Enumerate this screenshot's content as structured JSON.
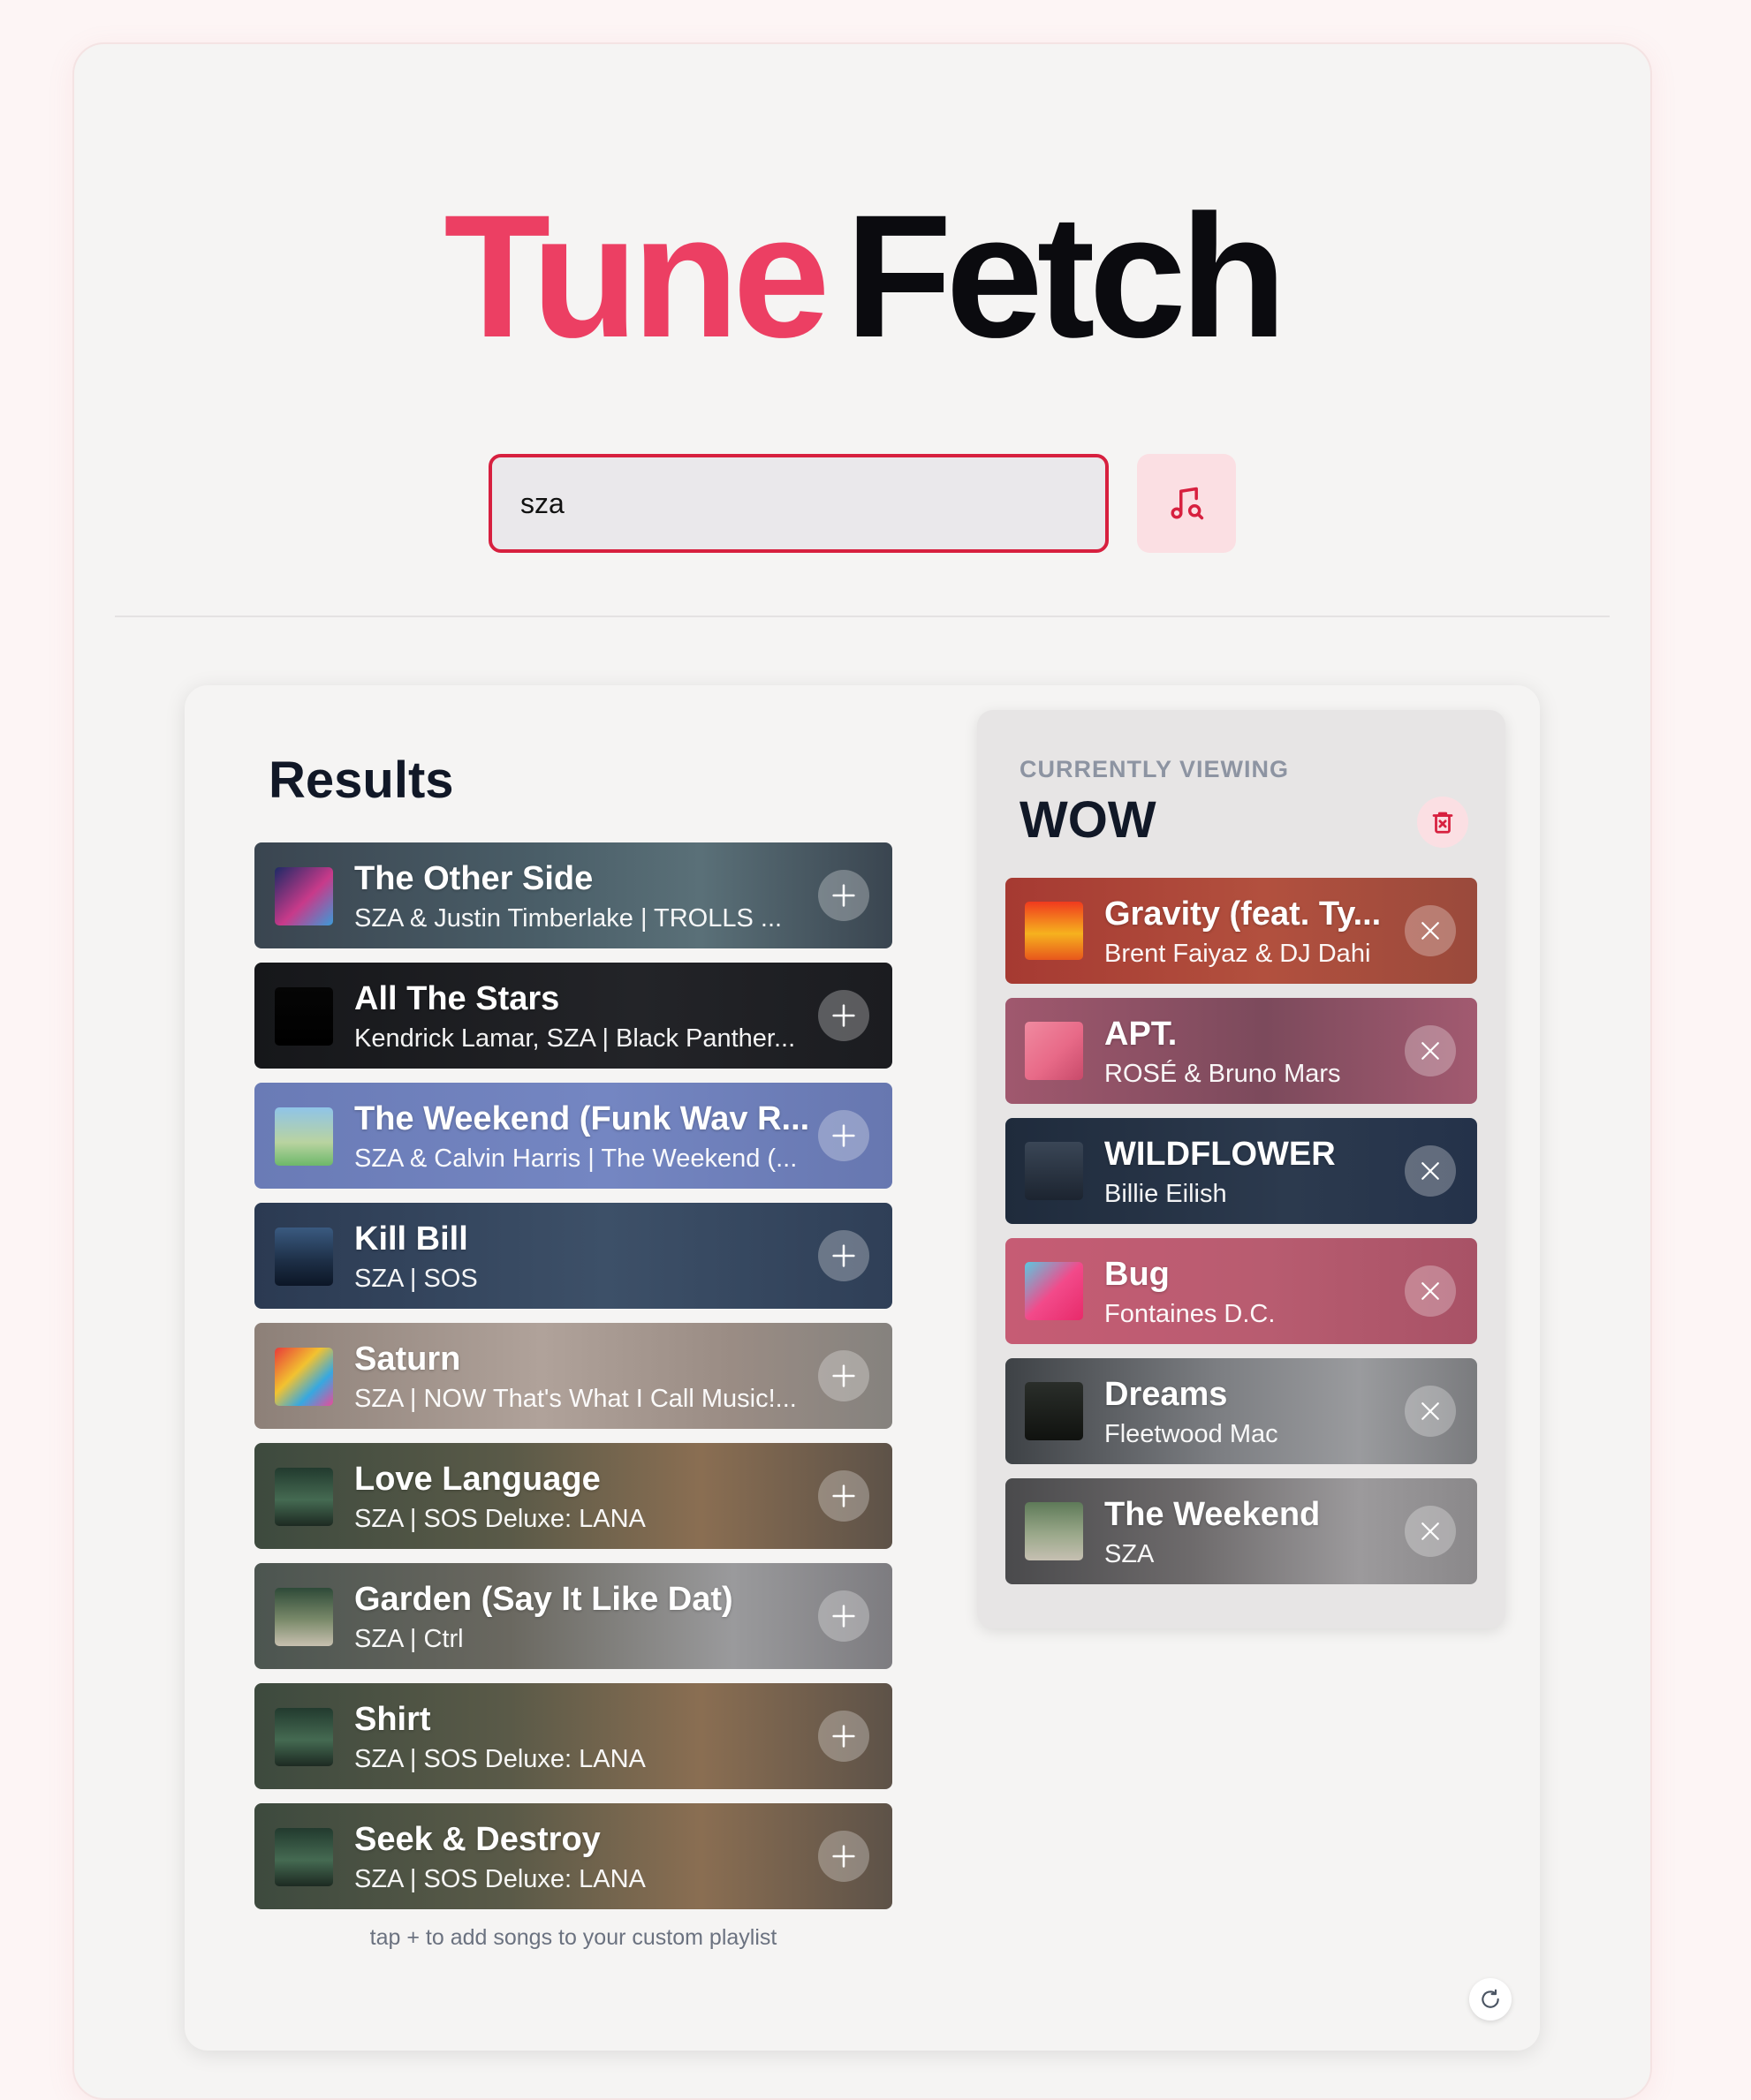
{
  "app": {
    "logo_part1": "Tune",
    "logo_part2": "Fetch",
    "brand_color": "#ec3f63"
  },
  "search": {
    "value": "sza",
    "button_icon": "music-search-icon"
  },
  "results": {
    "title": "Results",
    "hint": "tap + to add songs to your custom playlist",
    "items": [
      {
        "title": "The Other Side",
        "subtitle": "SZA & Justin Timberlake | TROLLS ...",
        "bg": "linear-gradient(90deg,#3a4550 0%,#4a5e68 45%,#5a7078 70%,#3a4550 100%)",
        "art": "linear-gradient(135deg,#1d2a66,#c83a8a 55%,#3b9bd8)"
      },
      {
        "title": "All The Stars",
        "subtitle": "Kendrick Lamar, SZA | Black Panther...",
        "bg": "linear-gradient(90deg,#16171a 0%,#232428 60%,#1b1c20 100%)",
        "art": "linear-gradient(180deg,#050505,#000000)"
      },
      {
        "title": "The Weekend (Funk Wav R...",
        "subtitle": "SZA & Calvin Harris | The Weekend (...",
        "bg": "linear-gradient(90deg,#6a7bb6 0%,#7486c2 55%,#6777b0 100%)",
        "art": "linear-gradient(180deg,#8fc4e8,#b9d3a0 60%,#6db86a)"
      },
      {
        "title": "Kill Bill",
        "subtitle": "SZA | SOS",
        "bg": "linear-gradient(90deg,#2b3a52 0%,#3d5068 55%,#2f3f57 100%)",
        "art": "linear-gradient(180deg,#3a5a80,#1c2d44 60%,#0c1626)"
      },
      {
        "title": "Saturn",
        "subtitle": "SZA | NOW That's What I Call Music!...",
        "bg": "linear-gradient(90deg,#8d8078 0%,#b0a29a 45%,#9a8c84 75%,#85827e 100%)",
        "art": "linear-gradient(135deg,#e83a3a,#f2c230 40%,#37a8e0 70%,#e84b9a)"
      },
      {
        "title": "Love Language",
        "subtitle": "SZA | SOS Deluxe: LANA",
        "bg": "linear-gradient(90deg,#3d4a3e 0%,#5a5a48 40%,#8a6e52 70%,#5d5248 100%)",
        "art": "linear-gradient(180deg,#223a2e,#456a52 55%,#1d2a22)"
      },
      {
        "title": "Garden (Say It Like Dat)",
        "subtitle": "SZA | Ctrl",
        "bg": "linear-gradient(90deg,#4c5550 0%,#6a6860 40%,#9a9a9c 75%,#7d7c80 100%)",
        "art": "linear-gradient(180deg,#2e4a38,#7a8a6a 55%,#c8c0b0)"
      },
      {
        "title": "Shirt",
        "subtitle": "SZA | SOS Deluxe: LANA",
        "bg": "linear-gradient(90deg,#3d4a3e 0%,#5a5a48 40%,#8a6e52 70%,#5d5248 100%)",
        "art": "linear-gradient(180deg,#223a2e,#456a52 55%,#1d2a22)"
      },
      {
        "title": "Seek & Destroy",
        "subtitle": "SZA | SOS Deluxe: LANA",
        "bg": "linear-gradient(90deg,#3d4a3e 0%,#5a5a48 40%,#8a6e52 70%,#5d5248 100%)",
        "art": "linear-gradient(180deg,#223a2e,#456a52 55%,#1d2a22)"
      }
    ]
  },
  "playlist": {
    "label": "CURRENTLY VIEWING",
    "name": "WOW",
    "delete_icon": "trash-icon",
    "items": [
      {
        "title": "Gravity (feat. Ty...",
        "subtitle": "Brent Faiyaz & DJ Dahi",
        "bg": "linear-gradient(90deg,#a63a32 0%,#b2503e 55%,#9a4a3c 100%)",
        "art": "linear-gradient(180deg,#f03a1e,#f6b21e 55%,#e8561c)"
      },
      {
        "title": "APT.",
        "subtitle": "ROSÉ & Bruno Mars",
        "bg": "linear-gradient(90deg,#a0586e 0%,#7c4a5c 55%,#a25a70 100%)",
        "art": "linear-gradient(135deg,#f08aa0,#e86a88 55%,#c84a6a)"
      },
      {
        "title": "WILDFLOWER",
        "subtitle": "Billie Eilish",
        "bg": "linear-gradient(90deg,#1f2b3c 0%,#2c3a4e 60%,#24324a 100%)",
        "art": "linear-gradient(180deg,#3a4656,#1c2430)"
      },
      {
        "title": "Bug",
        "subtitle": "Fontaines D.C.",
        "bg": "linear-gradient(90deg,#c65c74 0%,#b85c70 55%,#a85266 100%)",
        "art": "linear-gradient(135deg,#5ac8e0,#f24a8a 50%,#e82a6a)"
      },
      {
        "title": "Dreams",
        "subtitle": "Fleetwood Mac",
        "bg": "linear-gradient(90deg,#3e4246 0%,#7c7e82 45%,#9a9b9e 75%,#7a7b7e 100%)",
        "art": "linear-gradient(180deg,#2a2e2a,#10120f)"
      },
      {
        "title": "The Weekend",
        "subtitle": "SZA",
        "bg": "linear-gradient(90deg,#4a4a4c 0%,#6e6b6c 40%,#9c9a9c 75%,#8a888a 100%)",
        "art": "linear-gradient(180deg,#5e7a58,#9aa88a 55%,#c6c0b2)"
      }
    ]
  }
}
